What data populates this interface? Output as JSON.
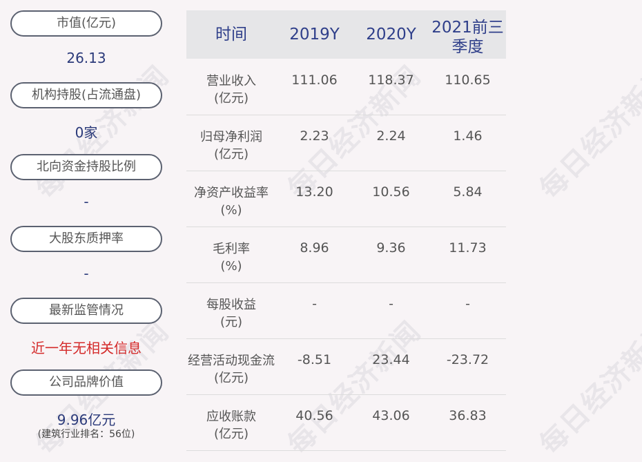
{
  "watermark": "每日经济新闻",
  "left": {
    "market_cap_label": "市值(亿元)",
    "market_cap_value": "26.13",
    "institution_label": "机构持股(占流通盘)",
    "institution_value": "0家",
    "northbound_label": "北向资金持股比例",
    "northbound_value": "-",
    "pledge_label": "大股东质押率",
    "pledge_value": "-",
    "regulation_label": "最新监管情况",
    "regulation_value": "近一年无相关信息",
    "brand_label": "公司品牌价值",
    "brand_value": "9.96亿元",
    "brand_rank": "(建筑行业排名：56位)"
  },
  "table": {
    "headers": [
      "时间",
      "2019Y",
      "2020Y",
      "2021前三季度"
    ],
    "rows": [
      {
        "label1": "营业收入",
        "label2": "(亿元)",
        "v2019": "111.06",
        "v2020": "118.37",
        "v2021": "110.65"
      },
      {
        "label1": "归母净利润",
        "label2": "(亿元)",
        "v2019": "2.23",
        "v2020": "2.24",
        "v2021": "1.46"
      },
      {
        "label1": "净资产收益率",
        "label2": "(%)",
        "v2019": "13.20",
        "v2020": "10.56",
        "v2021": "5.84"
      },
      {
        "label1": "毛利率",
        "label2": "(%)",
        "v2019": "8.96",
        "v2020": "9.36",
        "v2021": "11.73"
      },
      {
        "label1": "每股收益",
        "label2": "(元)",
        "v2019": "-",
        "v2020": "-",
        "v2021": "-"
      },
      {
        "label1": "经营活动现金流",
        "label2": "(亿元)",
        "v2019": "-8.51",
        "v2020": "23.44",
        "v2021": "-23.72"
      },
      {
        "label1": "应收账款",
        "label2": "(亿元)",
        "v2019": "40.56",
        "v2020": "43.06",
        "v2021": "36.83"
      }
    ]
  }
}
